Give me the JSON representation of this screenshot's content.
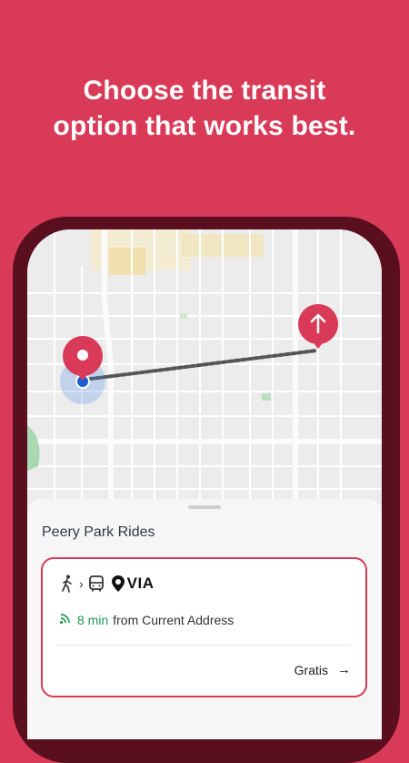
{
  "headline": {
    "line1": "Choose the transit",
    "line2": "option that works best."
  },
  "colors": {
    "brand": "#d93a57",
    "phone_frame": "#5a0f1f",
    "eta_green": "#1f9a52"
  },
  "map": {
    "origin_pin_icon": "location-pin-icon",
    "destination_pin_icon": "arrow-up-pin-icon"
  },
  "sheet": {
    "title": "Peery Park Rides",
    "option": {
      "icons": [
        "walking-person-icon",
        "chevron-right-icon",
        "bus-icon",
        "via-logo"
      ],
      "provider": "VIA",
      "eta_minutes": "8 min",
      "eta_suffix": "from Current Address",
      "price": "Gratis"
    }
  }
}
